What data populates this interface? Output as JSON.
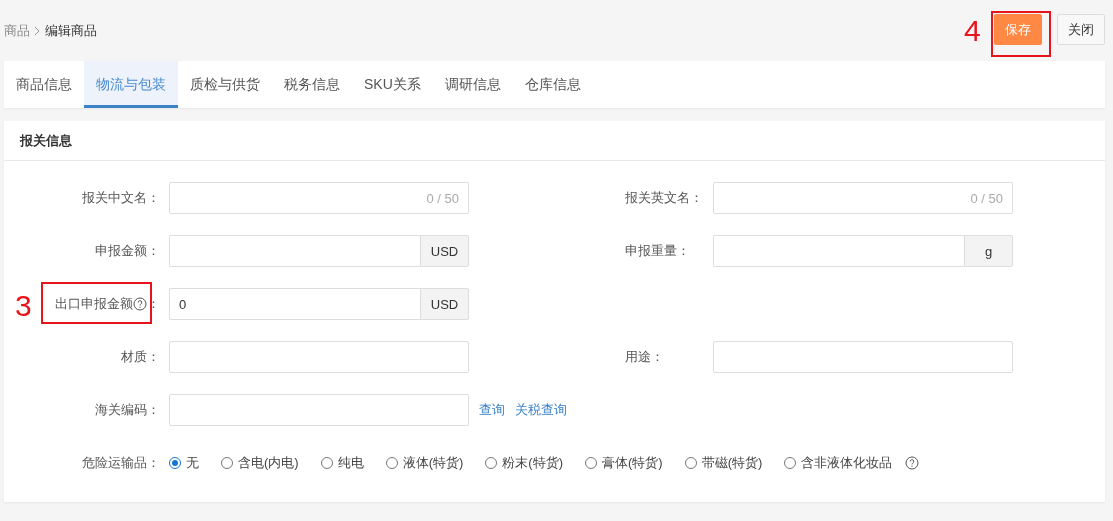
{
  "breadcrumb": [
    {
      "label": "商品",
      "current": false
    },
    {
      "label": "编辑商品",
      "current": true
    }
  ],
  "actions": [
    {
      "label": "保存",
      "kind": "primary",
      "annotation": "4"
    },
    {
      "label": "关闭",
      "kind": "default"
    }
  ],
  "tabs": [
    {
      "label": "商品信息",
      "selected": false
    },
    {
      "label": "物流与包装",
      "selected": true
    },
    {
      "label": "质检与供货",
      "selected": false
    },
    {
      "label": "税务信息",
      "selected": false
    },
    {
      "label": "SKU关系",
      "selected": false
    },
    {
      "label": "调研信息",
      "selected": false
    },
    {
      "label": "仓库信息",
      "selected": false
    }
  ],
  "section": {
    "title": "报关信息",
    "rows": [
      [
        {
          "label": "报关中文名：",
          "counter": "0 / 50"
        },
        {
          "label": "报关英文名：",
          "counter": "0 / 50"
        }
      ],
      [
        {
          "label": "申报金额：",
          "addon": "USD"
        },
        {
          "label": "申报重量：",
          "addon": "g"
        }
      ],
      [
        {
          "label": "出口申报金额",
          "help": true,
          "label_end": "：",
          "value": "0",
          "addon": "USD",
          "annotation": "3"
        }
      ],
      [
        {
          "label": "材质："
        },
        {
          "label": "用途："
        }
      ],
      [
        {
          "label": "海关编码：",
          "links": [
            "查询",
            "关税查询"
          ]
        }
      ]
    ],
    "hazard": {
      "label": "危险运输品：",
      "options": [
        {
          "label": "无",
          "selected": true
        },
        {
          "label": "含电(内电)",
          "selected": false
        },
        {
          "label": "纯电",
          "selected": false
        },
        {
          "label": "液体(特货)",
          "selected": false
        },
        {
          "label": "粉末(特货)",
          "selected": false
        },
        {
          "label": "膏体(特货)",
          "selected": false
        },
        {
          "label": "带磁(特货)",
          "selected": false
        },
        {
          "label": "含非液体化妆品",
          "selected": false,
          "help": true
        }
      ]
    }
  }
}
